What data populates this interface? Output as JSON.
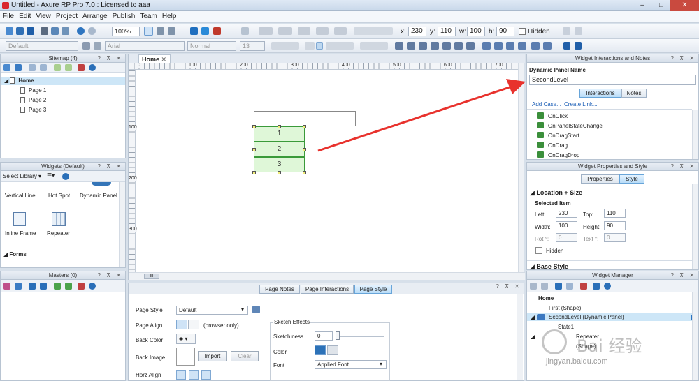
{
  "window": {
    "title": "Untitled - Axure RP Pro 7.0 : Licensed to aaa"
  },
  "menu": [
    "File",
    "Edit",
    "View",
    "Project",
    "Arrange",
    "Publish",
    "Team",
    "Help"
  ],
  "toolbar": {
    "zoom": "100%",
    "x_label": "x:",
    "x": "230",
    "y_label": "y:",
    "y": "110",
    "w_label": "w:",
    "w": "100",
    "h_label": "h:",
    "h": "90",
    "hidden_label": "Hidden",
    "style_default": "Default",
    "font": "Arial",
    "weight": "Normal",
    "size": "13"
  },
  "sitemap": {
    "title": "Sitemap (4)",
    "home": "Home",
    "pages": [
      "Page 1",
      "Page 2",
      "Page 3"
    ]
  },
  "widgets": {
    "title": "Widgets (Default)",
    "select_library": "Select Library",
    "items": [
      "Vertical Line",
      "Hot Spot",
      "Dynamic Panel",
      "Inline Frame",
      "Repeater"
    ],
    "forms_label": "Forms"
  },
  "masters": {
    "title": "Masters (0)"
  },
  "canvas": {
    "tab": "Home",
    "ruler_h": [
      "0",
      "100",
      "200",
      "300",
      "400",
      "500",
      "600",
      "700"
    ],
    "ruler_v": [
      "100",
      "200",
      "300"
    ],
    "states": [
      "1",
      "2",
      "3"
    ],
    "scroll_indicator": "III"
  },
  "bottom": {
    "tabs": [
      "Page Notes",
      "Page Interactions",
      "Page Style"
    ],
    "page_style_label": "Page Style",
    "page_style_value": "Default",
    "page_align_label": "Page Align",
    "browser_only": "(browser only)",
    "back_color_label": "Back Color",
    "back_image_label": "Back Image",
    "import_btn": "Import",
    "clear_btn": "Clear",
    "horz_align_label": "Horz Align",
    "sketch_effects": "Sketch Effects",
    "sketchiness_label": "Sketchiness",
    "sketchiness_value": "0",
    "color_label": "Color",
    "font_label": "Font",
    "font_value": "Applied Font"
  },
  "interactions": {
    "title": "Widget Interactions and Notes",
    "name_label": "Dynamic Panel Name",
    "name_value": "SecondLevel",
    "tab_interactions": "Interactions",
    "tab_notes": "Notes",
    "add_case": "Add Case...",
    "create_link": "Create Link...",
    "events": [
      "OnClick",
      "OnPanelStateChange",
      "OnDragStart",
      "OnDrag",
      "OnDragDrop"
    ]
  },
  "properties": {
    "title": "Widget Properties and Style",
    "tab_properties": "Properties",
    "tab_style": "Style",
    "location_size": "Location + Size",
    "selected_item": "Selected Item",
    "left_label": "Left:",
    "left": "230",
    "top_label": "Top:",
    "top": "110",
    "width_label": "Width:",
    "width": "100",
    "height_label": "Height:",
    "height": "90",
    "rot_label": "Rot °:",
    "rot": "0",
    "text_label": "Text °:",
    "text": "0",
    "hidden_label": "Hidden",
    "base_style": "Base Style"
  },
  "manager": {
    "title": "Widget Manager",
    "home": "Home",
    "first": "First (Shape)",
    "second": "SecondLevel (Dynamic Panel)",
    "state1": "State1",
    "repeater": "Repeater",
    "shape": "(Shape)"
  },
  "watermark": "jingyan.baidu.com"
}
